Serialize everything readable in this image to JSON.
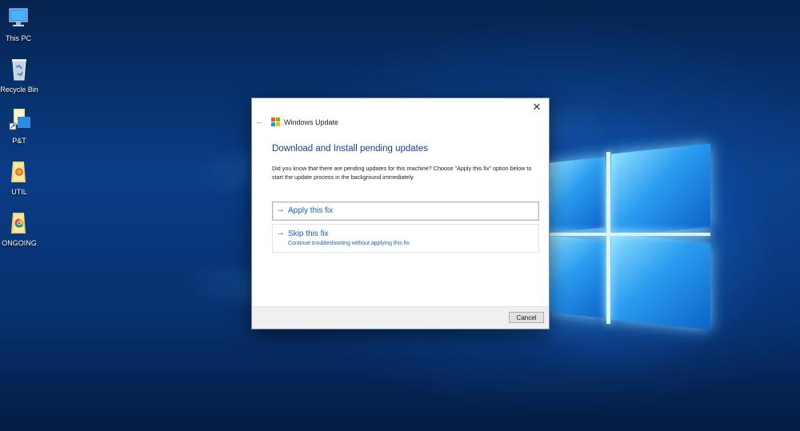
{
  "desktop": {
    "icons": [
      {
        "label": "This PC",
        "icon": "this-pc-icon"
      },
      {
        "label": "Recycle Bin",
        "icon": "recycle-bin-icon"
      },
      {
        "label": "P&T",
        "icon": "folder-shortcut-icon"
      },
      {
        "label": "UTIL",
        "icon": "folder-icon"
      },
      {
        "label": "ONGOING",
        "icon": "folder-icon"
      }
    ]
  },
  "dialog": {
    "title": "Windows Update",
    "heading": "Download and Install pending updates",
    "description": "Did you know that there are pending updates for this machine? Choose \"Apply this fix\" option below to start the update process in the background immediately.",
    "apply_fix": {
      "label": "Apply this fix"
    },
    "skip_fix": {
      "label": "Skip this fix",
      "sublabel": "Continue troubleshooting without applying this fix"
    },
    "cancel_label": "Cancel",
    "close_glyph": "✕",
    "back_glyph": "←",
    "arrow_glyph": "→"
  },
  "colors": {
    "link_blue": "#1a5fc8",
    "heading_blue": "#1a3f9a",
    "ms_red": "#f25022",
    "ms_green": "#7fba00",
    "ms_blue": "#00a4ef",
    "ms_yellow": "#ffb900"
  }
}
